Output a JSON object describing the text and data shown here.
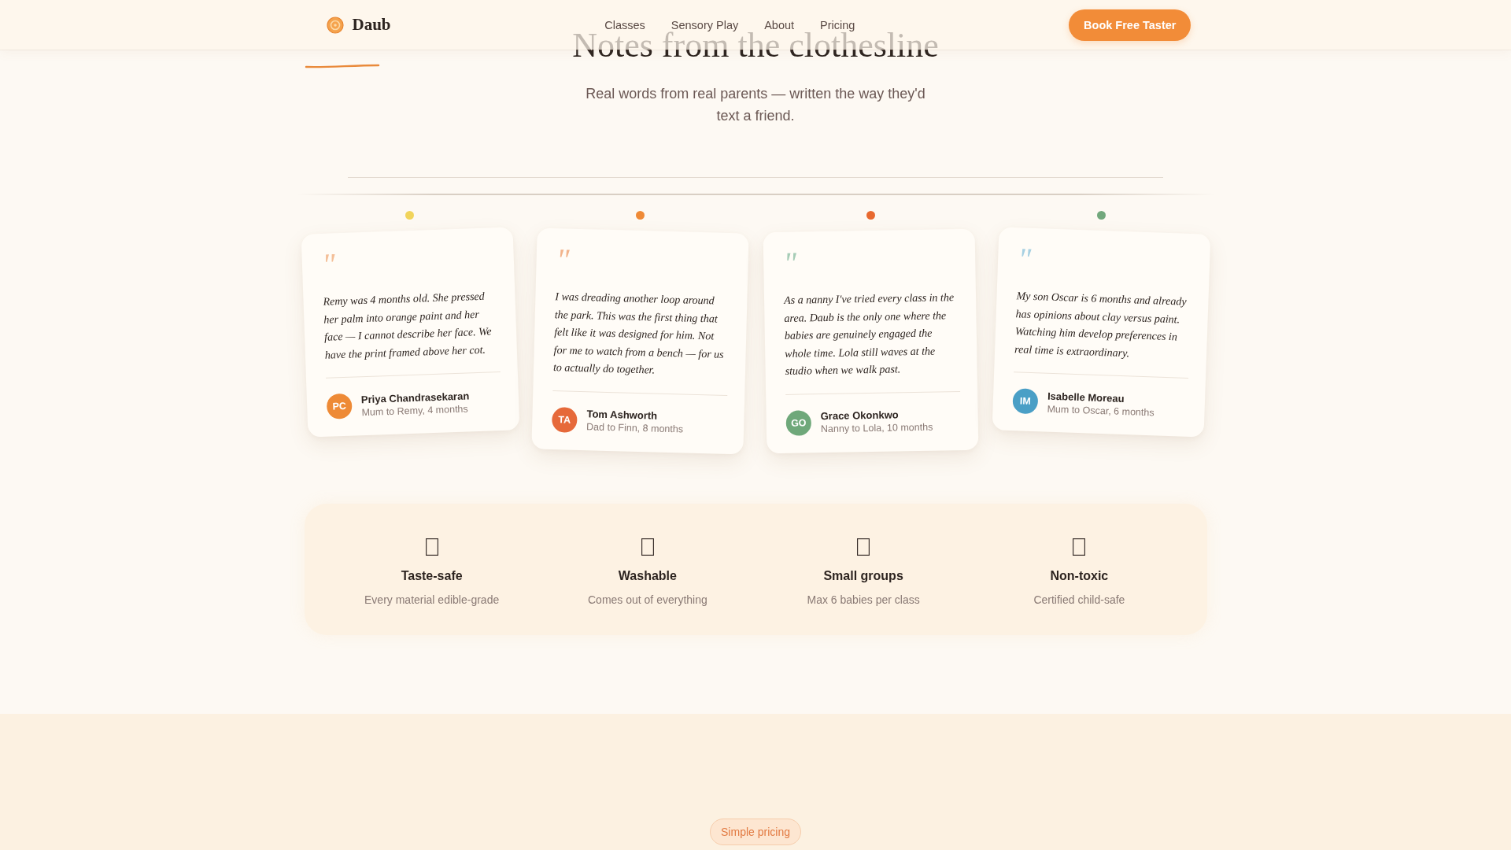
{
  "header": {
    "brand": "Daub",
    "nav": [
      {
        "label": "Classes"
      },
      {
        "label": "Sensory Play"
      },
      {
        "label": "About"
      },
      {
        "label": "Pricing"
      }
    ],
    "cta": "Book Free Taster"
  },
  "section": {
    "title": "Notes from the clothesline",
    "subtitle": "Real words from real parents — written the way they'd text a friend."
  },
  "testimonials": [
    {
      "pin": {
        "color": "#f1d45b"
      },
      "quote_mark": {
        "text": "\"",
        "color": "#f4bf98"
      },
      "quote": "Remy was 4 months old. She pressed her palm into orange paint and her face — I cannot describe her face. We have the print framed above her cot.",
      "avatar": {
        "initials": "PC",
        "color": "#ee8a36"
      },
      "name": "Priya Chandrasekaran",
      "role": "Mum to Remy, 4 months"
    },
    {
      "pin": {
        "color": "#ef8a36"
      },
      "quote_mark": {
        "text": "\"",
        "color": "#f2b48c"
      },
      "quote": "I was dreading another loop around the park. This was the first thing that felt like it was designed for him. Not for me to watch from a bench — for us to actually do together.",
      "avatar": {
        "initials": "TA",
        "color": "#e6693a"
      },
      "name": "Tom Ashworth",
      "role": "Dad to Finn, 8 months"
    },
    {
      "pin": {
        "color": "#e8692f"
      },
      "quote_mark": {
        "text": "\"",
        "color": "#a6ccb6"
      },
      "quote": "As a nanny I've tried every class in the area. Daub is the only one where the babies are genuinely engaged the whole time. Lola still waves at the studio when we walk past.",
      "avatar": {
        "initials": "GO",
        "color": "#6fa87a"
      },
      "name": "Grace Okonkwo",
      "role": "Nanny to Lola, 10 months"
    },
    {
      "pin": {
        "color": "#72a87c"
      },
      "quote_mark": {
        "text": "\"",
        "color": "#a7d0e2"
      },
      "quote": "My son Oscar is 6 months and already has opinions about clay versus paint. Watching him develop preferences in real time is extraordinary.",
      "avatar": {
        "initials": "IM",
        "color": "#4a9fc6"
      },
      "name": "Isabelle Moreau",
      "role": "Mum to Oscar, 6 months"
    }
  ],
  "features": [
    {
      "title": "Taste-safe",
      "description": "Every material edible-grade"
    },
    {
      "title": "Washable",
      "description": "Comes out of everything"
    },
    {
      "title": "Small groups",
      "description": "Max 6 babies per class"
    },
    {
      "title": "Non-toxic",
      "description": "Certified child-safe"
    }
  ],
  "pricing": {
    "eyebrow": "Simple pricing"
  }
}
